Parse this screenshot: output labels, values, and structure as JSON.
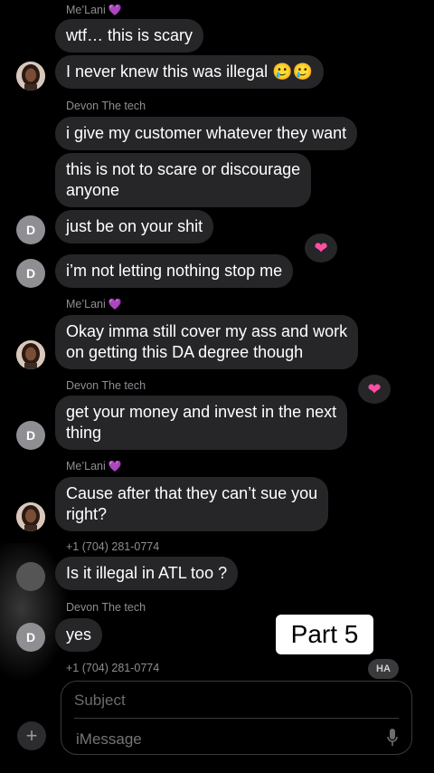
{
  "messages": [
    {
      "sender": "Me’Lani",
      "sender_heart": "💜"
    },
    {
      "text": "wtf… this is scary"
    },
    {
      "text": "I never knew this was illegal 🥲🥲"
    },
    {
      "sender": "Devon The tech"
    },
    {
      "text": "i give my customer whatever they want"
    },
    {
      "text_line1": "this is not to scare or discourage",
      "text_line2": "anyone"
    },
    {
      "text": "just be on your shit"
    },
    {
      "text": "i’m not letting nothing stop me",
      "tapback": "❤"
    },
    {
      "sender": "Me’Lani",
      "sender_heart": "💜"
    },
    {
      "text_line1": "Okay imma still cover my ass and work",
      "text_line2": "on getting this DA degree though"
    },
    {
      "sender": "Devon The tech"
    },
    {
      "text_line1": "get your money and invest in the next",
      "text_line2": "thing",
      "tapback": "❤"
    },
    {
      "sender": "Me’Lani",
      "sender_heart": "💜"
    },
    {
      "text_line1": "Cause after that they can’t sue you",
      "text_line2": "right?"
    },
    {
      "sender": "+1 (704) 281-0774"
    },
    {
      "text": "Is it illegal in ATL too ?"
    },
    {
      "sender": "Devon The tech"
    },
    {
      "text": "yes"
    },
    {
      "sender": "+1 (704) 281-0774"
    }
  ],
  "avatars": {
    "devon_initial": "D"
  },
  "overlay": {
    "part_label": "Part 5",
    "ha_tapback": "HA"
  },
  "composer": {
    "subject_placeholder": "Subject",
    "message_placeholder": "iMessage",
    "plus": "+"
  },
  "colors": {
    "bubble": "#262628",
    "background": "#000000",
    "heart_tapback": "#ff4fa3",
    "sender_heart": "#a64dff"
  }
}
